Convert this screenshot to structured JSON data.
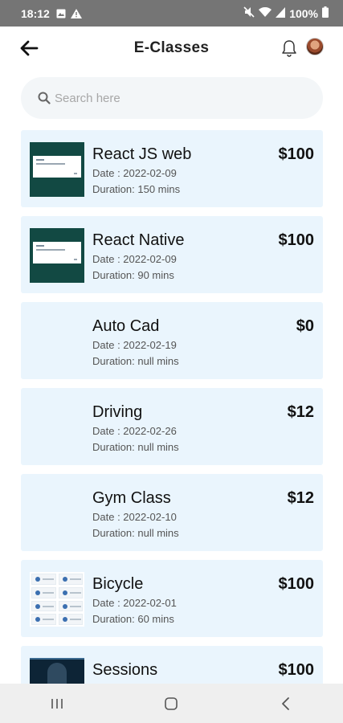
{
  "status_bar": {
    "time": "18:12",
    "battery": "100%"
  },
  "header": {
    "title": "E-Classes"
  },
  "search": {
    "placeholder": "Search here"
  },
  "classes": [
    {
      "name": "React JS web",
      "date": "Date : 2022-02-09",
      "duration": "Duration:  150 mins",
      "price": "$100",
      "thumbnail": "slide"
    },
    {
      "name": "React Native",
      "date": "Date : 2022-02-09",
      "duration": "Duration:  90 mins",
      "price": "$100",
      "thumbnail": "slide"
    },
    {
      "name": "Auto Cad",
      "date": "Date : 2022-02-19",
      "duration": "Duration:  null mins",
      "price": "$0",
      "thumbnail": "none"
    },
    {
      "name": "Driving",
      "date": "Date : 2022-02-26",
      "duration": "Duration:  null mins",
      "price": "$12",
      "thumbnail": "none"
    },
    {
      "name": "Gym Class",
      "date": "Date : 2022-02-10",
      "duration": "Duration:  null mins",
      "price": "$12",
      "thumbnail": "none"
    },
    {
      "name": "Bicycle",
      "date": "Date : 2022-02-01",
      "duration": "Duration:  60 mins",
      "price": "$100",
      "thumbnail": "grid"
    },
    {
      "name": "Sessions",
      "date": "",
      "duration": "",
      "price": "$100",
      "thumbnail": "video"
    }
  ],
  "colors": {
    "status_bar": "#757575",
    "card_background": "#eaf5fd",
    "search_background": "#f3f6f8",
    "slide_thumbnail": "#124943",
    "nav_bar": "#efefef"
  },
  "icons": {
    "back": "arrow-left-icon",
    "notifications": "bell-icon",
    "search": "search-icon",
    "nav_recents": "recents-icon",
    "nav_home": "home-icon",
    "nav_back": "chevron-left-icon"
  }
}
